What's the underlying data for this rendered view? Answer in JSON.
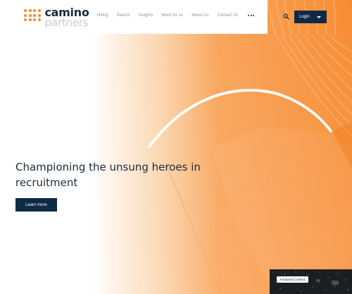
{
  "header": {
    "logo": {
      "line1": "camino",
      "line2": "partners"
    },
    "nav_items": [
      {
        "label": "Hiring"
      },
      {
        "label": "Search"
      },
      {
        "label": "Insights"
      },
      {
        "label": "Work for us"
      },
      {
        "label": "About Us"
      },
      {
        "label": "Contact Us"
      }
    ],
    "more_icon": "more-dots-icon",
    "search_icon": "search-icon",
    "login_label": "Login",
    "login_icon": "caret-down-icon"
  },
  "hero": {
    "headline": "Championing the unsung heroes in recruitment",
    "cta_label": "Learn more"
  },
  "video": {
    "badge_label": "Featured Content"
  },
  "colors": {
    "brand_orange": "#f68a2e",
    "navy": "#0f2a45",
    "text_dark": "#1d2b3a",
    "logo_gray": "#c7cdd4"
  }
}
